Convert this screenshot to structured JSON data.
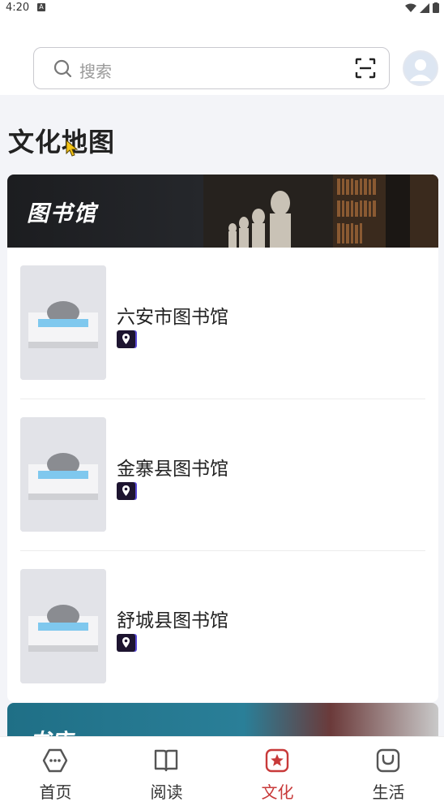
{
  "status_bar": {
    "time": "4:20",
    "notification_badge": "A"
  },
  "search": {
    "placeholder": "搜索"
  },
  "page": {
    "title": "文化地图"
  },
  "library_section": {
    "title": "图书馆",
    "items": [
      {
        "name": "六安市图书馆"
      },
      {
        "name": "金寨县图书馆"
      },
      {
        "name": "舒城县图书馆"
      }
    ]
  },
  "bookstore_section": {
    "title": "书店"
  },
  "tabs": [
    {
      "label": "首页",
      "icon": "home-icon",
      "active": false
    },
    {
      "label": "阅读",
      "icon": "book-icon",
      "active": false
    },
    {
      "label": "文化",
      "icon": "culture-star-icon",
      "active": true
    },
    {
      "label": "生活",
      "icon": "life-bag-icon",
      "active": false
    }
  ],
  "colors": {
    "accent": "#c83a3a",
    "background": "#f3f4f8",
    "banner": "#1c1d20"
  }
}
